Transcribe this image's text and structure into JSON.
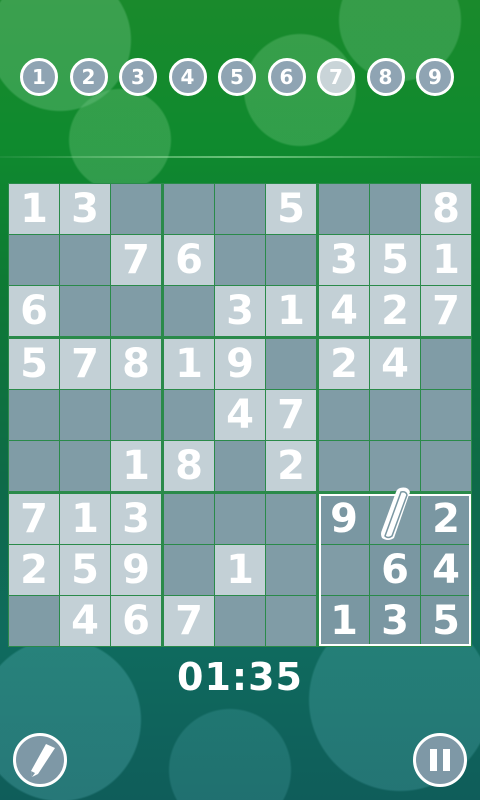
{
  "number_bar": [
    {
      "label": "1",
      "active": false
    },
    {
      "label": "2",
      "active": false
    },
    {
      "label": "3",
      "active": false
    },
    {
      "label": "4",
      "active": false
    },
    {
      "label": "5",
      "active": false
    },
    {
      "label": "6",
      "active": false
    },
    {
      "label": "7",
      "active": true
    },
    {
      "label": "8",
      "active": false
    },
    {
      "label": "9",
      "active": false
    }
  ],
  "board": [
    [
      "1",
      "3",
      "",
      "",
      "",
      "5",
      "",
      "",
      "8"
    ],
    [
      "",
      "",
      "7",
      "6",
      "",
      "",
      "3",
      "5",
      "1"
    ],
    [
      "6",
      "",
      "",
      "",
      "3",
      "1",
      "4",
      "2",
      "7"
    ],
    [
      "5",
      "7",
      "8",
      "1",
      "9",
      "",
      "2",
      "4",
      ""
    ],
    [
      "",
      "",
      "",
      "",
      "4",
      "7",
      "",
      "",
      ""
    ],
    [
      "",
      "",
      "1",
      "8",
      "",
      "2",
      "",
      "",
      ""
    ],
    [
      "7",
      "1",
      "3",
      "",
      "",
      "",
      "9",
      "",
      "2"
    ],
    [
      "2",
      "5",
      "9",
      "",
      "1",
      "",
      "",
      "6",
      "4"
    ],
    [
      "",
      "4",
      "6",
      "7",
      "",
      "",
      "1",
      "3",
      "5"
    ]
  ],
  "user_entries": [
    [
      6,
      6
    ],
    [
      6,
      8
    ],
    [
      7,
      7
    ],
    [
      7,
      8
    ],
    [
      8,
      6
    ],
    [
      8,
      7
    ],
    [
      8,
      8
    ]
  ],
  "selected_box": 8,
  "eraser_cell": [
    6,
    7
  ],
  "timer": "01:35",
  "icons": {
    "pencil_button": "pencil-icon",
    "pause_button": "pause-icon",
    "eraser": "eraser-icon"
  },
  "colors": {
    "given_cell": "#c3d0d6",
    "empty_cell": "#809ca6",
    "grid_line": "#2a8a4a",
    "background_top": "#1a8a2c",
    "background_bottom": "#0f5d5a"
  }
}
